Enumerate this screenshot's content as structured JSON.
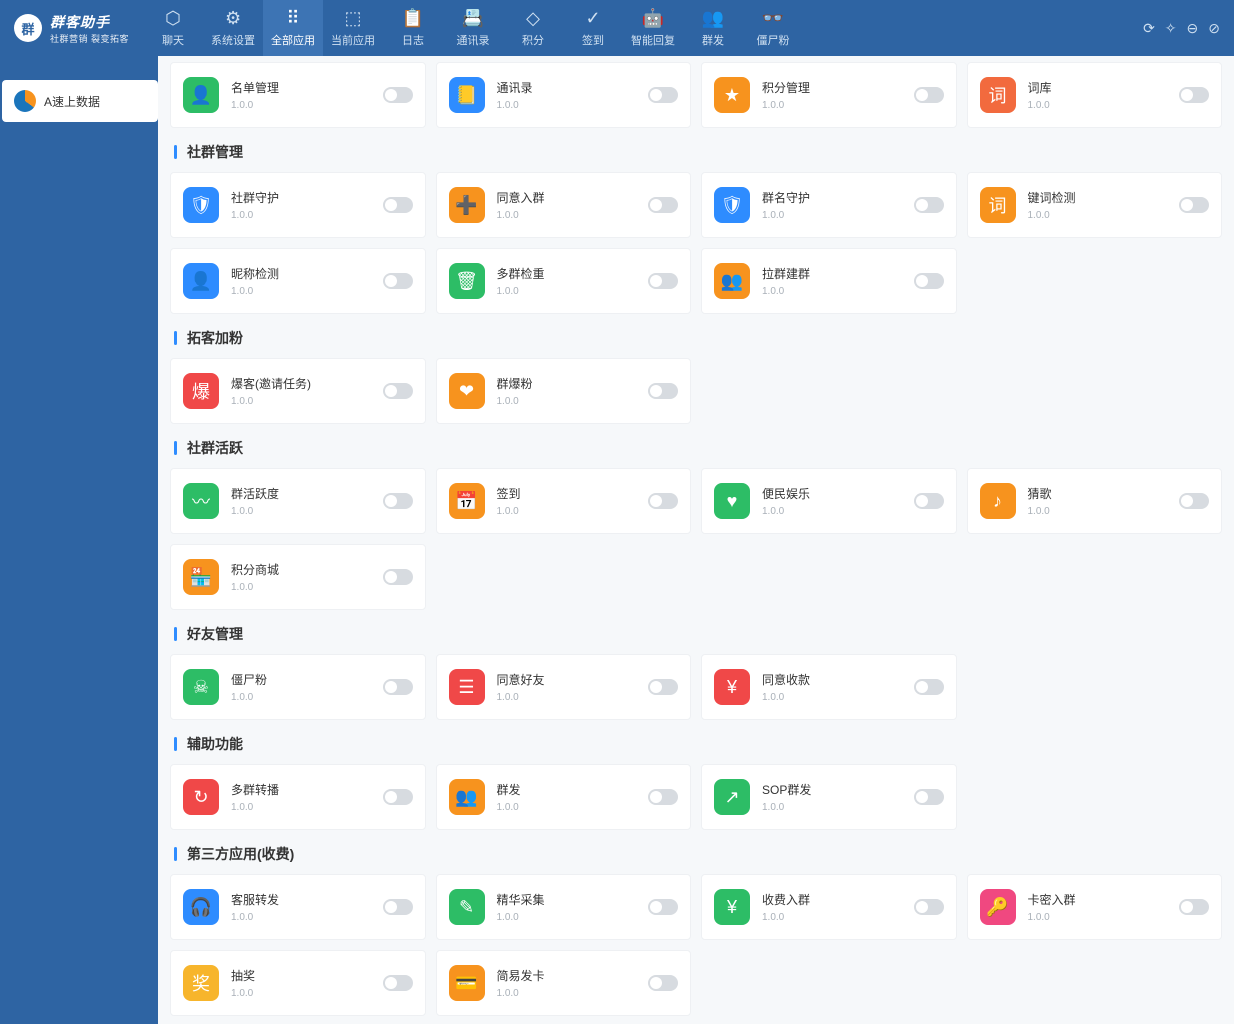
{
  "brand": {
    "badge": "群",
    "name": "群客助手",
    "sub": "社群营销 裂变拓客"
  },
  "nav": [
    {
      "k": "chat",
      "label": "聊天"
    },
    {
      "k": "sys",
      "label": "系统设置"
    },
    {
      "k": "allapp",
      "label": "全部应用",
      "active": true
    },
    {
      "k": "curapp",
      "label": "当前应用"
    },
    {
      "k": "log",
      "label": "日志"
    },
    {
      "k": "book",
      "label": "通讯录"
    },
    {
      "k": "point",
      "label": "积分"
    },
    {
      "k": "sign",
      "label": "签到"
    },
    {
      "k": "ai",
      "label": "智能回复"
    },
    {
      "k": "mass",
      "label": "群发"
    },
    {
      "k": "zombie",
      "label": "僵尸粉"
    }
  ],
  "sidebar": {
    "tab": "A速上数据"
  },
  "sections": [
    {
      "title": null,
      "apps": [
        {
          "name": "名单管理",
          "ver": "1.0.0",
          "ico": "👤",
          "cls": "c-green"
        },
        {
          "name": "通讯录",
          "ver": "1.0.0",
          "ico": "📒",
          "cls": "c-blue"
        },
        {
          "name": "积分管理",
          "ver": "1.0.0",
          "ico": "★",
          "cls": "c-orange"
        },
        {
          "name": "词库",
          "ver": "1.0.0",
          "ico": "词",
          "cls": "c-obox"
        }
      ]
    },
    {
      "title": "社群管理",
      "apps": [
        {
          "name": "社群守护",
          "ver": "1.0.0",
          "ico": "🛡",
          "cls": "c-blue"
        },
        {
          "name": "同意入群",
          "ver": "1.0.0",
          "ico": "➕",
          "cls": "c-orange"
        },
        {
          "name": "群名守护",
          "ver": "1.0.0",
          "ico": "🛡",
          "cls": "c-blue"
        },
        {
          "name": "键词检测",
          "ver": "1.0.0",
          "ico": "词",
          "cls": "c-orange"
        },
        {
          "name": "昵称检测",
          "ver": "1.0.0",
          "ico": "👤",
          "cls": "c-blue"
        },
        {
          "name": "多群检重",
          "ver": "1.0.0",
          "ico": "🗑",
          "cls": "c-green"
        },
        {
          "name": "拉群建群",
          "ver": "1.0.0",
          "ico": "👥",
          "cls": "c-orange"
        }
      ]
    },
    {
      "title": "拓客加粉",
      "apps": [
        {
          "name": "爆客(邀请任务)",
          "ver": "1.0.0",
          "ico": "爆",
          "cls": "c-red"
        },
        {
          "name": "群爆粉",
          "ver": "1.0.0",
          "ico": "❤",
          "cls": "c-orange"
        }
      ]
    },
    {
      "title": "社群活跃",
      "apps": [
        {
          "name": "群活跃度",
          "ver": "1.0.0",
          "ico": "〰",
          "cls": "c-green"
        },
        {
          "name": "签到",
          "ver": "1.0.0",
          "ico": "📅",
          "cls": "c-orange"
        },
        {
          "name": "便民娱乐",
          "ver": "1.0.0",
          "ico": "♥",
          "cls": "c-green"
        },
        {
          "name": "猜歌",
          "ver": "1.0.0",
          "ico": "♪",
          "cls": "c-orange"
        },
        {
          "name": "积分商城",
          "ver": "1.0.0",
          "ico": "🏪",
          "cls": "c-orange"
        }
      ]
    },
    {
      "title": "好友管理",
      "apps": [
        {
          "name": "僵尸粉",
          "ver": "1.0.0",
          "ico": "☠",
          "cls": "c-green"
        },
        {
          "name": "同意好友",
          "ver": "1.0.0",
          "ico": "☰",
          "cls": "c-red"
        },
        {
          "name": "同意收款",
          "ver": "1.0.0",
          "ico": "¥",
          "cls": "c-red"
        }
      ]
    },
    {
      "title": "辅助功能",
      "apps": [
        {
          "name": "多群转播",
          "ver": "1.0.0",
          "ico": "↻",
          "cls": "c-red"
        },
        {
          "name": "群发",
          "ver": "1.0.0",
          "ico": "👥",
          "cls": "c-orange"
        },
        {
          "name": "SOP群发",
          "ver": "1.0.0",
          "ico": "↗",
          "cls": "c-green"
        }
      ]
    },
    {
      "title": "第三方应用(收费)",
      "apps": [
        {
          "name": "客服转发",
          "ver": "1.0.0",
          "ico": "🎧",
          "cls": "c-blue"
        },
        {
          "name": "精华采集",
          "ver": "1.0.0",
          "ico": "✎",
          "cls": "c-green"
        },
        {
          "name": "收费入群",
          "ver": "1.0.0",
          "ico": "¥",
          "cls": "c-green"
        },
        {
          "name": "卡密入群",
          "ver": "1.0.0",
          "ico": "🔑",
          "cls": "c-pink"
        },
        {
          "name": "抽奖",
          "ver": "1.0.0",
          "ico": "奖",
          "cls": "c-yellow"
        },
        {
          "name": "简易发卡",
          "ver": "1.0.0",
          "ico": "💳",
          "cls": "c-orange"
        }
      ]
    }
  ],
  "nav_icons": {
    "chat": "⬡",
    "sys": "⚙",
    "allapp": "⠿",
    "curapp": "⬚",
    "log": "📋",
    "book": "📇",
    "point": "◇",
    "sign": "✓",
    "ai": "🤖",
    "mass": "👥",
    "zombie": "👓"
  }
}
